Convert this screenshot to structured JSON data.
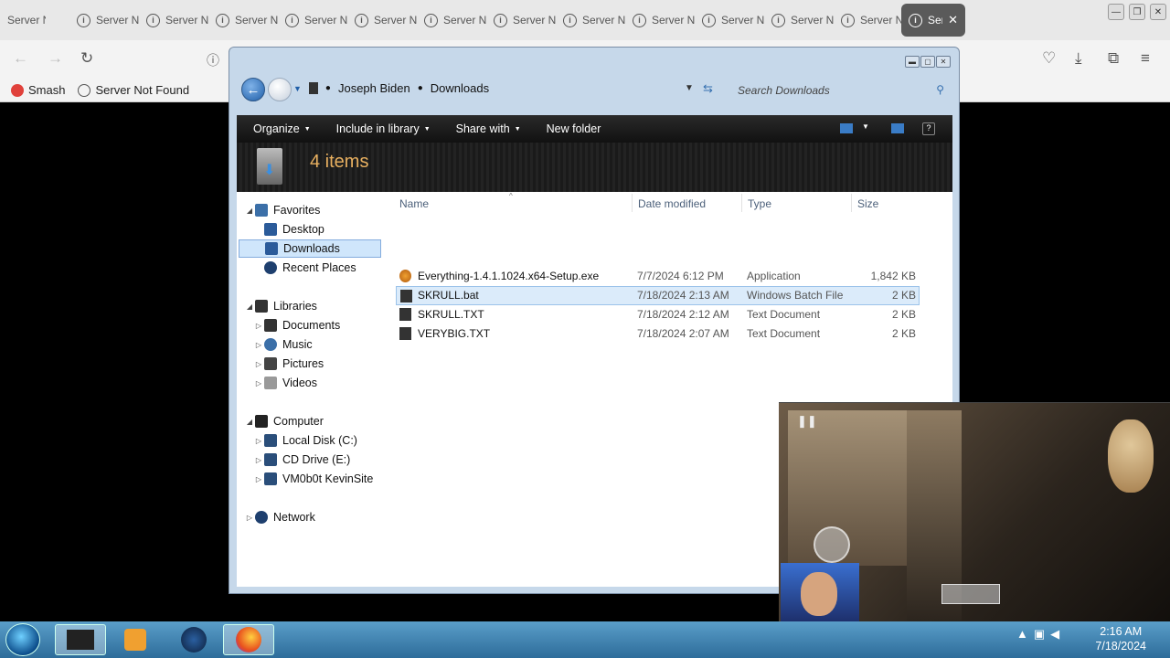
{
  "browser": {
    "tabs": [
      {
        "label": "Server Not Found"
      },
      {
        "label": "Server Not Found"
      },
      {
        "label": "Server Not Found"
      },
      {
        "label": "Server Not Found"
      },
      {
        "label": "Server Not Found"
      },
      {
        "label": "Server Not Found"
      },
      {
        "label": "Server Not Found"
      },
      {
        "label": "Server Not Found"
      },
      {
        "label": "Server Not Found"
      },
      {
        "label": "Server Not Found"
      },
      {
        "label": "Server Not Found"
      },
      {
        "label": "Server Not Found"
      },
      {
        "label": "Server Not Found"
      }
    ],
    "active_tab_label": "Server Not Found",
    "bookmarks": [
      {
        "label": "Smash",
        "color": "#e0413b"
      },
      {
        "label": "Server Not Found",
        "color": "#555555"
      }
    ]
  },
  "explorer": {
    "breadcrumb": [
      "Joseph Biden",
      "Downloads"
    ],
    "search_placeholder": "Search Downloads",
    "commands": [
      "Organize",
      "Include in library",
      "Share with",
      "New folder"
    ],
    "item_count": "4 items",
    "nav": {
      "favorites_label": "Favorites",
      "favorites": [
        "Desktop",
        "Downloads",
        "Recent Places"
      ],
      "libraries_label": "Libraries",
      "libraries": [
        "Documents",
        "Music",
        "Pictures",
        "Videos"
      ],
      "computer_label": "Computer",
      "computer": [
        "Local Disk (C:)",
        "CD Drive (E:)",
        "VM0b0t KevinSite"
      ],
      "network_label": "Network"
    },
    "columns": {
      "name": "Name",
      "date": "Date modified",
      "type": "Type",
      "size": "Size"
    },
    "files": [
      {
        "name": "Everything-1.4.1.1024.x64-Setup.exe",
        "date": "7/7/2024 6:12 PM",
        "type": "Application",
        "size": "1,842 KB"
      },
      {
        "name": "SKRULL.bat",
        "date": "7/18/2024 2:13 AM",
        "type": "Windows Batch File",
        "size": "2 KB"
      },
      {
        "name": "SKRULL.TXT",
        "date": "7/18/2024 2:12 AM",
        "type": "Text Document",
        "size": "2 KB"
      },
      {
        "name": "VERYBIG.TXT",
        "date": "7/18/2024 2:07 AM",
        "type": "Text Document",
        "size": "2 KB"
      }
    ],
    "selected_file": "SKRULL.bat",
    "selected_nav": "Downloads"
  },
  "taskbar": {
    "time": "2:16 AM",
    "date": "7/18/2024"
  },
  "colors": {
    "accent": "#3670b0",
    "item_count": "#e8b060",
    "selection": "#dbebfa"
  }
}
